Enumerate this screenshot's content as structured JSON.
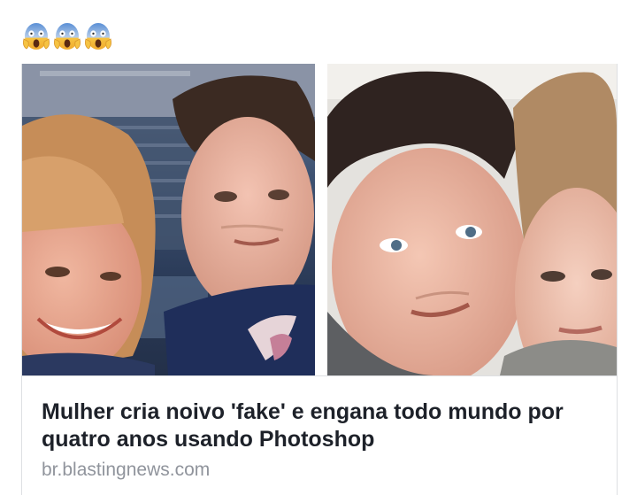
{
  "post": {
    "reaction_emojis": [
      "face-screaming-in-fear-emoji",
      "face-screaming-in-fear-emoji",
      "face-screaming-in-fear-emoji"
    ],
    "emoji_char": "😱"
  },
  "link_card": {
    "headline": "Mulher cria noivo 'fake' e engana todo mundo por quatro anos usando Photoshop",
    "domain": "br.blastingnews.com",
    "images": [
      {
        "name": "photo-left",
        "description_icon": "couple-photo-stadium"
      },
      {
        "name": "photo-right",
        "description_icon": "couple-selfie-photo"
      }
    ]
  },
  "colors": {
    "headline": "#1d2129",
    "domain": "#90949c",
    "border": "#dddfe2",
    "emoji_yellow": "#f6c343",
    "emoji_blue": "#5a8fd6"
  }
}
